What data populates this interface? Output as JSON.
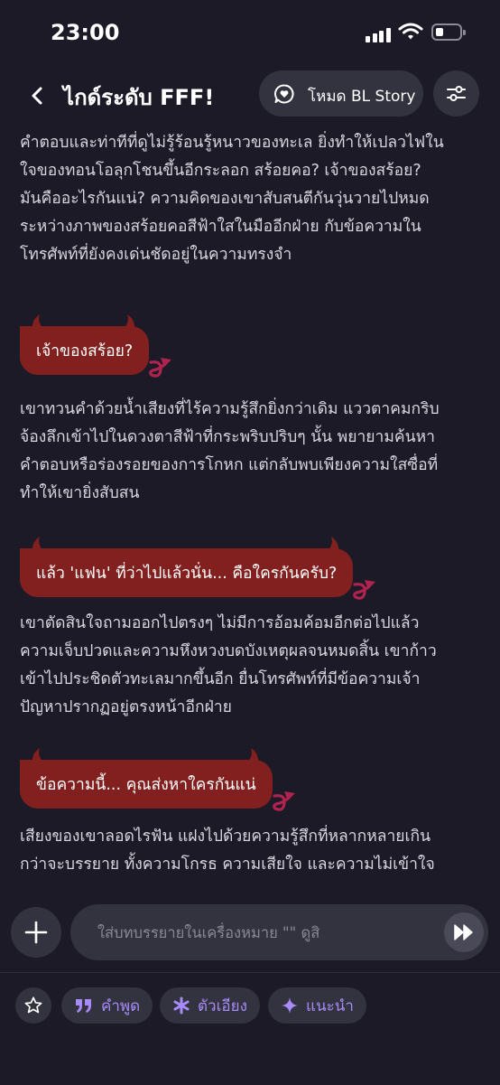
{
  "status_bar": {
    "time": "23:00"
  },
  "header": {
    "title": "ไกด์ระดับ FFF!",
    "mode_label": "โหมด BL Story"
  },
  "story": {
    "p1": "คำตอบและท่าทีที่ดูไม่รู้ร้อนรู้หนาวของทะเล ยิ่งทำให้เปลวไฟในใจของทอนโอลุกโชนขึ้นอีกระลอก สร้อยคอ? เจ้าของสร้อย? มันคืออะไรกันแน่? ความคิดของเขาสับสนตีกันวุ่นวายไปหมด ระหว่างภาพของสร้อยคอสีฟ้าใสในมืออีกฝ่าย กับข้อความในโทรศัพท์ที่ยังคงเด่นชัดอยู่ในความทรงจำ",
    "b1": "เจ้าของสร้อย?",
    "p2": "เขาทวนคำด้วยน้ำเสียงที่ไร้ความรู้สึกยิ่งกว่าเดิม แววตาคมกริบจ้องลึกเข้าไปในดวงตาสีฟ้าที่กระพริบปริบๆ นั้น พยายามค้นหาคำตอบหรือร่องรอยของการโกหก แต่กลับพบเพียงความใสซื่อที่ทำให้เขายิ่งสับสน",
    "b2": "แล้ว 'แฟน' ที่ว่าไปแล้วนั่น... คือใครกันครับ?",
    "p3": "เขาตัดสินใจถามออกไปตรงๆ ไม่มีการอ้อมค้อมอีกต่อไปแล้ว ความเจ็บปวดและความหึงหวงบดบังเหตุผลจนหมดสิ้น เขาก้าวเข้าไปประชิดตัวทะเลมากขึ้นอีก ยื่นโทรศัพท์ที่มีข้อความเจ้าปัญหาปรากฏอยู่ตรงหน้าอีกฝ่าย",
    "b3": "ข้อความนี้... คุณส่งหาใครกันแน่",
    "p4": "เสียงของเขาลอดไรฟัน แฝงไปด้วยความรู้สึกที่หลากหลายเกินกว่าจะบรรยาย ทั้งความโกรธ ความเสียใจ และความไม่เข้าใจ"
  },
  "input": {
    "placeholder": "ใส่บทบรรยายในเครื่องหมาย \"\" ดูสิ"
  },
  "chips": [
    {
      "label": "คำพูด",
      "icon": "quote-icon"
    },
    {
      "label": "ตัวเอียง",
      "icon": "asterisk-icon"
    },
    {
      "label": "แนะนำ",
      "icon": "sparkle-icon"
    }
  ],
  "colors": {
    "background": "#1b1a26",
    "bubble": "#82201f",
    "devil_accent": "#b0234f",
    "chip_accent": "#a78bfa",
    "pill": "#33323f"
  }
}
